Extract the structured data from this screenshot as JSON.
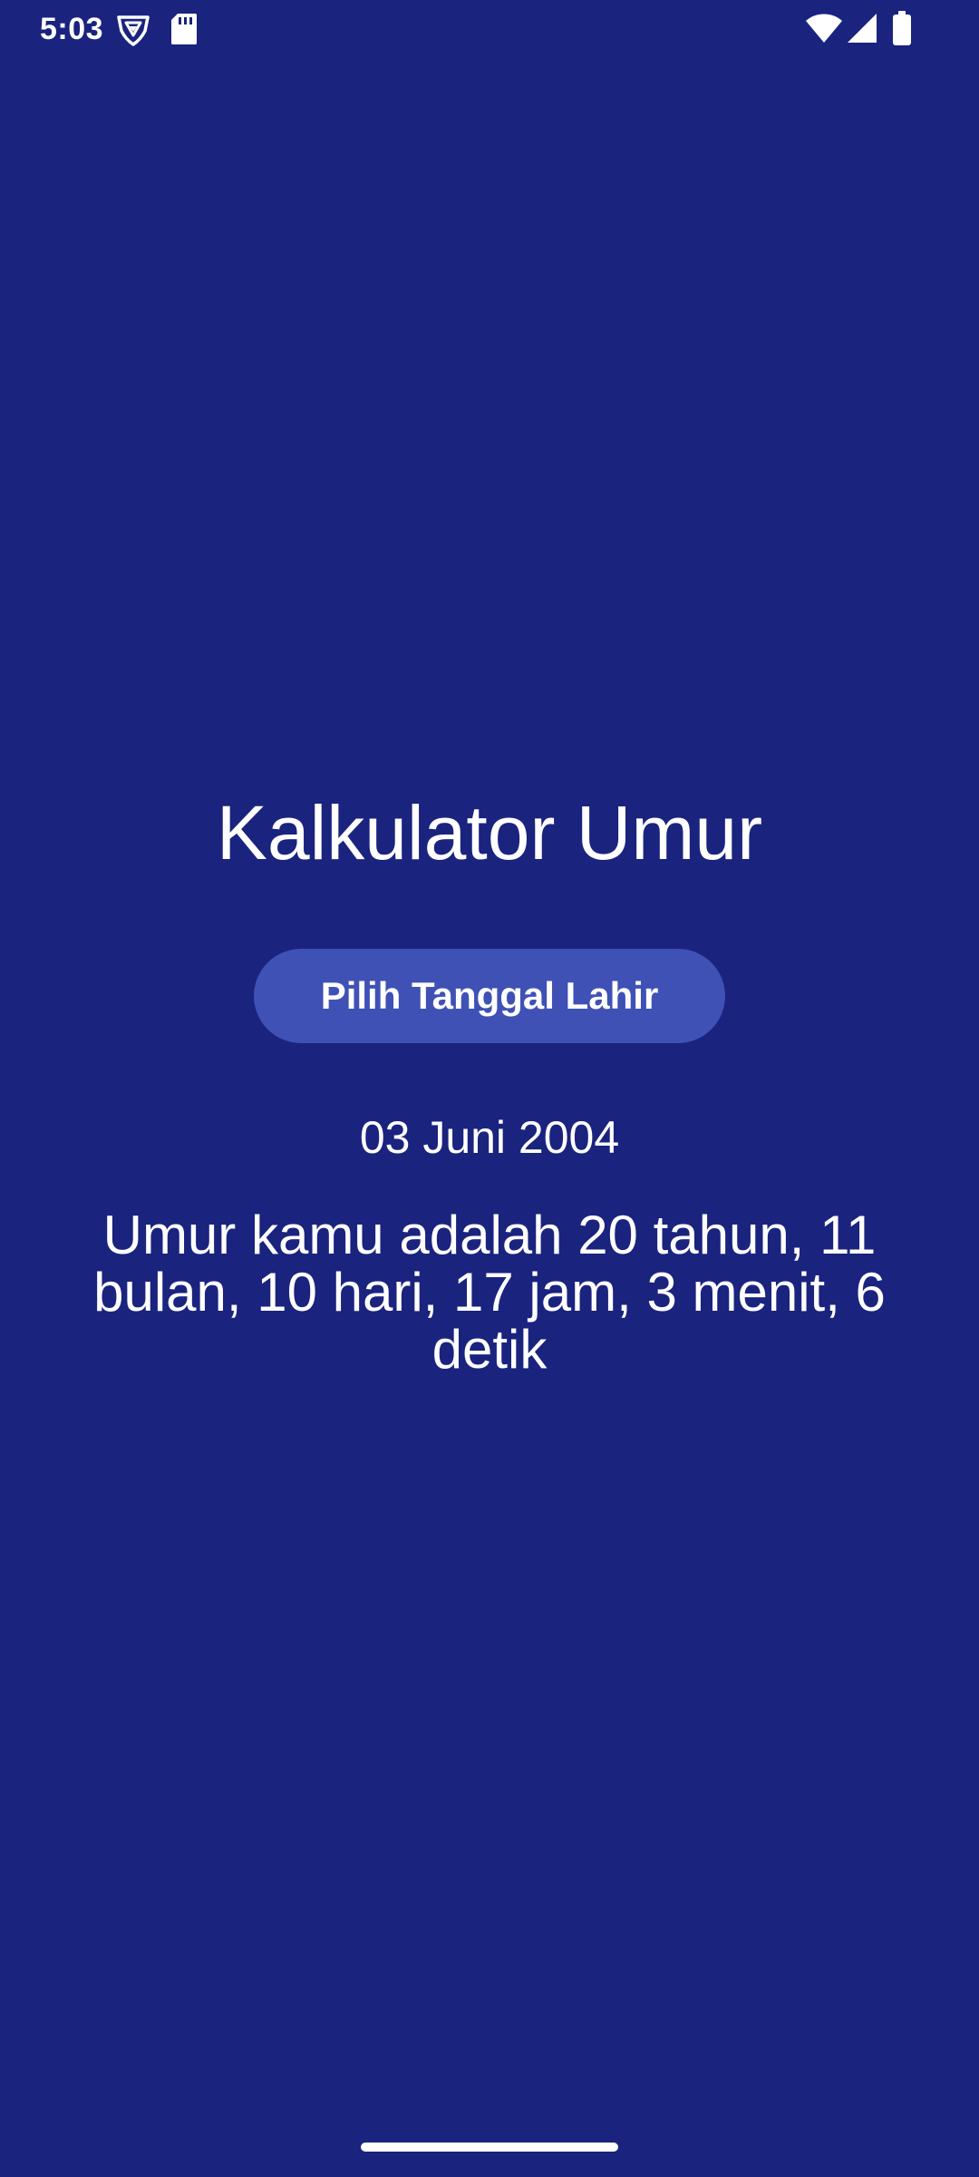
{
  "status_bar": {
    "time": "5:03",
    "left_icons": [
      "vpn-shield-icon",
      "sd-card-icon"
    ],
    "right_icons": [
      "wifi-icon",
      "cellular-signal-icon",
      "battery-icon"
    ]
  },
  "main": {
    "title": "Kalkulator Umur",
    "pick_button_label": "Pilih Tanggal Lahir",
    "selected_date": "03 Juni 2004",
    "age_result": "Umur kamu adalah 20 tahun, 11 bulan, 10 hari, 17 jam, 3 menit, 6 detik"
  },
  "colors": {
    "background": "#1a237e",
    "button": "#3f51b5",
    "text": "#ffffff"
  }
}
